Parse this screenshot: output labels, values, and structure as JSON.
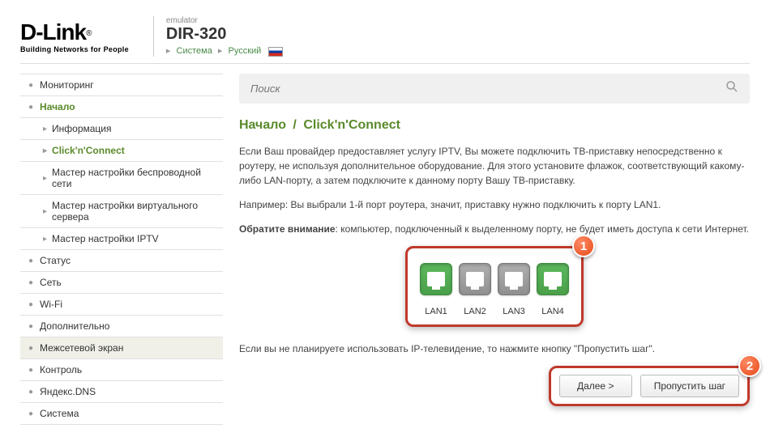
{
  "header": {
    "logo_main": "D-Link",
    "logo_sub": "Building Networks for People",
    "emulator": "emulator",
    "device": "DIR-320",
    "bc_system": "Система",
    "bc_lang": "Русский"
  },
  "sidebar": {
    "items": [
      {
        "label": "Мониторинг"
      },
      {
        "label": "Начало",
        "active": true
      },
      {
        "label": "Статус"
      },
      {
        "label": "Сеть"
      },
      {
        "label": "Wi-Fi"
      },
      {
        "label": "Дополнительно"
      },
      {
        "label": "Межсетевой экран",
        "highlighted": true
      },
      {
        "label": "Контроль"
      },
      {
        "label": "Яндекс.DNS"
      },
      {
        "label": "Система"
      }
    ],
    "subitems": [
      {
        "label": "Информация"
      },
      {
        "label": "Click'n'Connect",
        "active": true
      },
      {
        "label": "Мастер настройки беспроводной сети"
      },
      {
        "label": "Мастер настройки виртуального сервера"
      },
      {
        "label": "Мастер настройки IPTV"
      }
    ]
  },
  "search": {
    "placeholder": "Поиск"
  },
  "main": {
    "breadcrumb_root": "Начало",
    "breadcrumb_current": "Click'n'Connect",
    "para1": "Если Ваш провайдер предоставляет услугу IPTV, Вы можете подключить ТВ-приставку непосредственно к роутеру, не используя дополнительное оборудование. Для этого установите флажок, соответствующий какому-либо LAN-порту, а затем подключите к данному порту Вашу ТВ-приставку.",
    "para2": "Например: Вы выбрали 1-й порт роутера, значит, приставку нужно подключить к порту LAN1.",
    "para3_bold": "Обратите внимание",
    "para3_rest": ": компьютер, подключенный к выделенному порту, не будет иметь доступа к сети Интернет.",
    "para4": "Если вы не планируете использовать IP-телевидение, то нажмите кнопку \"Пропустить шаг\".",
    "ports": [
      {
        "label": "LAN1",
        "selected": true
      },
      {
        "label": "LAN2",
        "selected": false
      },
      {
        "label": "LAN3",
        "selected": false
      },
      {
        "label": "LAN4",
        "selected": true
      }
    ],
    "btn_next": "Далее >",
    "btn_skip": "Пропустить шаг",
    "badge1": "1",
    "badge2": "2"
  }
}
